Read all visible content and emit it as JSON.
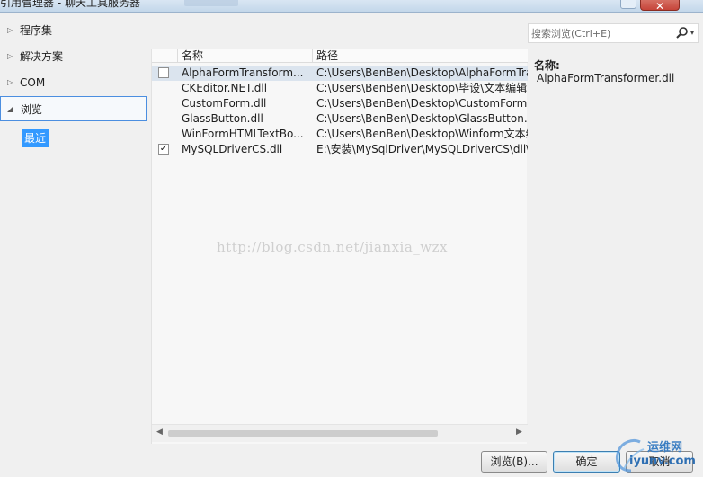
{
  "window": {
    "title": "引用管理器 - 聊天工具服务器",
    "close_glyph": "✕"
  },
  "nav": {
    "items": [
      {
        "label": "程序集",
        "arrow": "▷"
      },
      {
        "label": "解决方案",
        "arrow": "▷"
      },
      {
        "label": "COM",
        "arrow": "▷"
      },
      {
        "label": "浏览",
        "arrow": "◢"
      }
    ],
    "sub_item": "最近"
  },
  "list": {
    "columns": [
      "名称",
      "路径"
    ],
    "rows": [
      {
        "checked": false,
        "check_mark": "",
        "name": "AlphaFormTransform...",
        "path": "C:\\Users\\BenBen\\Desktop\\AlphaFormTra..."
      },
      {
        "checked": null,
        "check_mark": "",
        "name": "CKEditor.NET.dll",
        "path": "C:\\Users\\BenBen\\Desktop\\毕设\\文本编辑..."
      },
      {
        "checked": null,
        "check_mark": "",
        "name": "CustomForm.dll",
        "path": "C:\\Users\\BenBen\\Desktop\\CustomForm...."
      },
      {
        "checked": null,
        "check_mark": "",
        "name": "GlassButton.dll",
        "path": "C:\\Users\\BenBen\\Desktop\\GlassButton.d..."
      },
      {
        "checked": null,
        "check_mark": "",
        "name": "WinFormHTMLTextBo...",
        "path": "C:\\Users\\BenBen\\Desktop\\Winform文本编..."
      },
      {
        "checked": true,
        "check_mark": "✓",
        "name": "MySQLDriverCS.dll",
        "path": "E:\\安装\\MySqlDriver\\MySQLDriverCS\\dll\\..."
      }
    ],
    "watermark": "http://blog.csdn.net/jianxia_wzx",
    "scroll_left": "◀",
    "scroll_right": "▶"
  },
  "search": {
    "placeholder": "搜索浏览(Ctrl+E)",
    "dropdown_glyph": "▾"
  },
  "detail": {
    "name_label": "名称:",
    "name_value": "AlphaFormTransformer.dll"
  },
  "buttons": {
    "browse": "浏览(B)...",
    "ok": "确定",
    "cancel": "取消"
  },
  "logo": {
    "text_top": "运维网",
    "text_bottom": "iyunv.com"
  },
  "icons": {
    "search": "search-icon",
    "expand": "triangle-icon",
    "checkbox": "checkbox-icon"
  },
  "colors": {
    "selection": "#3399ff",
    "nav_selected_border": "#4b8ee0",
    "row_selected": "#dbe4ee"
  }
}
